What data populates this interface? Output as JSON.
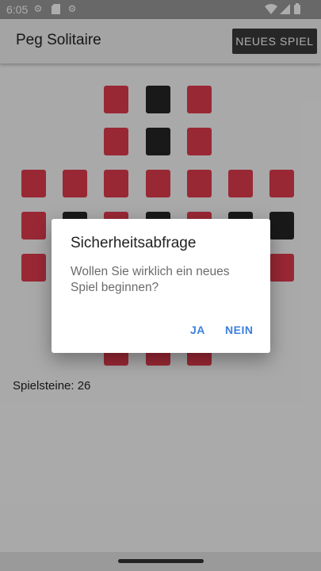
{
  "status_bar": {
    "time": "6:05"
  },
  "app_bar": {
    "title": "Peg Solitaire",
    "new_game_label": "NEUES SPIEL"
  },
  "board": {
    "peg_color": "#e23b4f",
    "empty_color": "#262626",
    "rows": [
      [
        "none",
        "none",
        "peg",
        "empty",
        "peg",
        "none",
        "none"
      ],
      [
        "none",
        "none",
        "peg",
        "empty",
        "peg",
        "none",
        "none"
      ],
      [
        "peg",
        "peg",
        "peg",
        "peg",
        "peg",
        "peg",
        "peg"
      ],
      [
        "peg",
        "empty",
        "peg",
        "empty",
        "peg",
        "empty",
        "empty"
      ],
      [
        "peg",
        "peg",
        "peg",
        "peg",
        "peg",
        "peg",
        "peg"
      ],
      [
        "none",
        "none",
        "peg",
        "peg",
        "peg",
        "none",
        "none"
      ],
      [
        "none",
        "none",
        "peg",
        "peg",
        "peg",
        "none",
        "none"
      ]
    ]
  },
  "peg_count": "Spielsteine: 26",
  "dialog": {
    "title": "Sicherheitsabfrage",
    "message": "Wollen Sie wirklich ein neues Spiel beginnen?",
    "yes_label": "JA",
    "no_label": "NEIN"
  }
}
